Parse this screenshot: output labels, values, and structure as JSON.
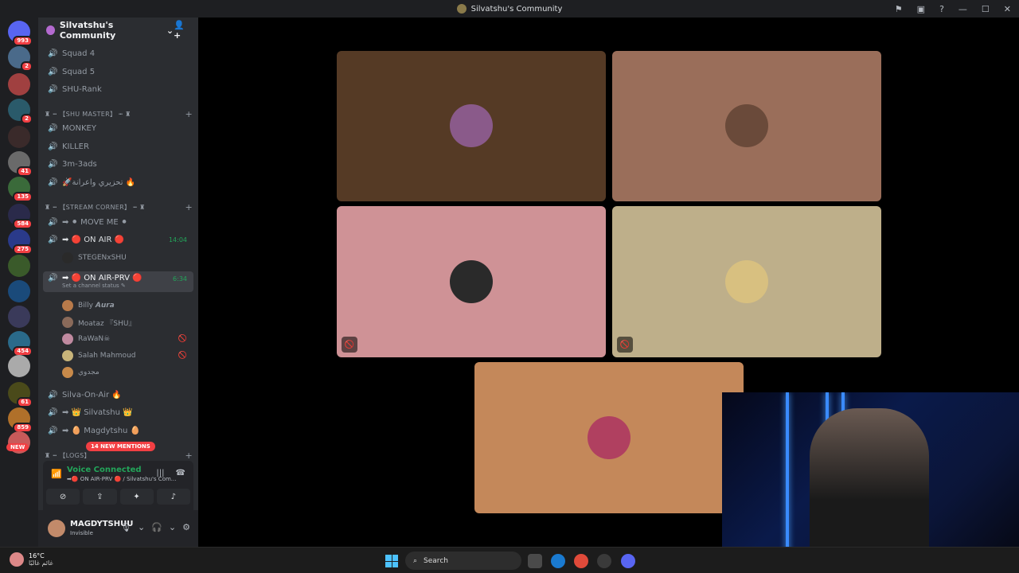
{
  "window": {
    "title": "Silvatshu's Community"
  },
  "servers": [
    {
      "badge": "993",
      "color": "#5865f2"
    },
    {
      "badge": "2",
      "color": "#4a6a8a"
    },
    {
      "badge": "",
      "color": "#a04040"
    },
    {
      "badge": "2",
      "color": "#2a5a6a"
    },
    {
      "badge": "",
      "color": "#3a2a2a"
    },
    {
      "badge": "41",
      "color": "#6a6a6a"
    },
    {
      "badge": "135",
      "color": "#3a6a3a"
    },
    {
      "badge": "584",
      "color": "#2a2a4a"
    },
    {
      "badge": "275",
      "color": "#2a3a8a"
    },
    {
      "badge": "",
      "color": "#3a5a2a"
    },
    {
      "badge": "",
      "color": "#1a4a7a"
    },
    {
      "badge": "",
      "color": "#3a3a5a"
    },
    {
      "badge": "454",
      "color": "#2a6a8a"
    },
    {
      "badge": "",
      "color": "#aaaaaa"
    },
    {
      "badge": "61",
      "color": "#4a4a1a"
    },
    {
      "badge": "859",
      "color": "#b0702a"
    },
    {
      "badge": "",
      "color": "#c85a5a"
    }
  ],
  "new_label": "NEW",
  "sidebar": {
    "server_name": "Silvatshu's Community",
    "channels_top": [
      {
        "name": "Squad 4"
      },
      {
        "name": "Squad 5"
      },
      {
        "name": "SHU-Rank"
      }
    ],
    "cat_shu_master": "♜ ┅ 【SHU MASTER】 ┅ ♜",
    "channels_shu_master": [
      {
        "name": "MONKEY"
      },
      {
        "name": "KILLER"
      },
      {
        "name": "3m-3ads"
      },
      {
        "name": "🚀تحزيري واعرانة 🔥"
      }
    ],
    "cat_stream": "♜ ┅ 【STREAM CORNER】 ┅ ♜",
    "channel_moveme": "➡ ⚫ MOVE ME ⚫",
    "channel_onair": "➡ 🔴 ON AIR 🔴",
    "channel_onair_time": "14:04",
    "onair_user": "STEGENxSHU",
    "channel_prv": "➡ 🔴 ON AIR-PRV 🔴",
    "channel_prv_time": "6:34",
    "channel_prv_sub": "Set a channel status ✎",
    "prv_users": [
      {
        "name": "Billy 𝘼𝙪𝙧𝙖",
        "color": "#b87a4a"
      },
      {
        "name": "Moataz 『SHU』",
        "color": "#8a6a5a"
      },
      {
        "name": "RaWaN☠",
        "color": "#c08aa0"
      },
      {
        "name": "Salah Mahmoud",
        "color": "#c8b47a"
      },
      {
        "name": "مجدوي",
        "color": "#c88a4a"
      }
    ],
    "channels_bottom": [
      {
        "name": "Silva-On-Air 🔥"
      },
      {
        "name": "➡ 👑 Silvatshu 👑"
      },
      {
        "name": "➡ 🥚 Magdytshu 🥚"
      }
    ],
    "cat_logs": "♜ ┅ 【LOGS】",
    "mentions": "14 NEW MENTIONS"
  },
  "voice": {
    "status": "Voice Connected",
    "sub": "➡🔴 ON AIR-PRV 🔴 / Silvatshu's Com..."
  },
  "user": {
    "name": "MAGDYTSHUU",
    "status": "Invisible"
  },
  "tiles": [
    {
      "color": "#553a25",
      "avatar": "#8a5a8a",
      "muted": false
    },
    {
      "color": "#9a6e5a",
      "avatar": "#6a4a3a",
      "muted": false
    },
    {
      "color": "#cf9296",
      "avatar": "#2a2a2a",
      "muted": true
    },
    {
      "color": "#beaf8a",
      "avatar": "#d8c080",
      "muted": true
    },
    {
      "color": "#c4885a",
      "avatar": "#b04060",
      "muted": false
    }
  ],
  "taskbar": {
    "temp": "16°C",
    "weather_text": "غائم غالبًا",
    "search_label": "Search"
  }
}
